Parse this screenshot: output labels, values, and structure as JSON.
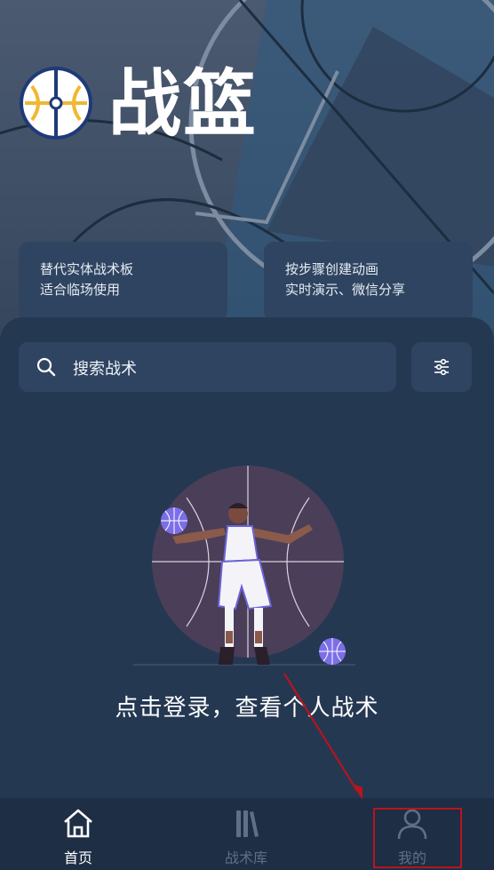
{
  "app": {
    "title": "战篮"
  },
  "features": {
    "left": {
      "line1": "替代实体战术板",
      "line2": "适合临场使用"
    },
    "right": {
      "line1": "按步骤创建动画",
      "line2": "实时演示、微信分享"
    }
  },
  "search": {
    "placeholder": "搜索战术"
  },
  "empty_state": {
    "message": "点击登录，查看个人战术"
  },
  "tabbar": {
    "items": [
      {
        "label": "首页",
        "icon": "home-icon",
        "active": true
      },
      {
        "label": "战术库",
        "icon": "library-icon",
        "active": false
      },
      {
        "label": "我的",
        "icon": "user-icon",
        "active": false
      }
    ]
  },
  "colors": {
    "background": "#243852",
    "card": "#2f4460",
    "tabbar": "#1d2e45",
    "annotation": "#b8141d"
  }
}
